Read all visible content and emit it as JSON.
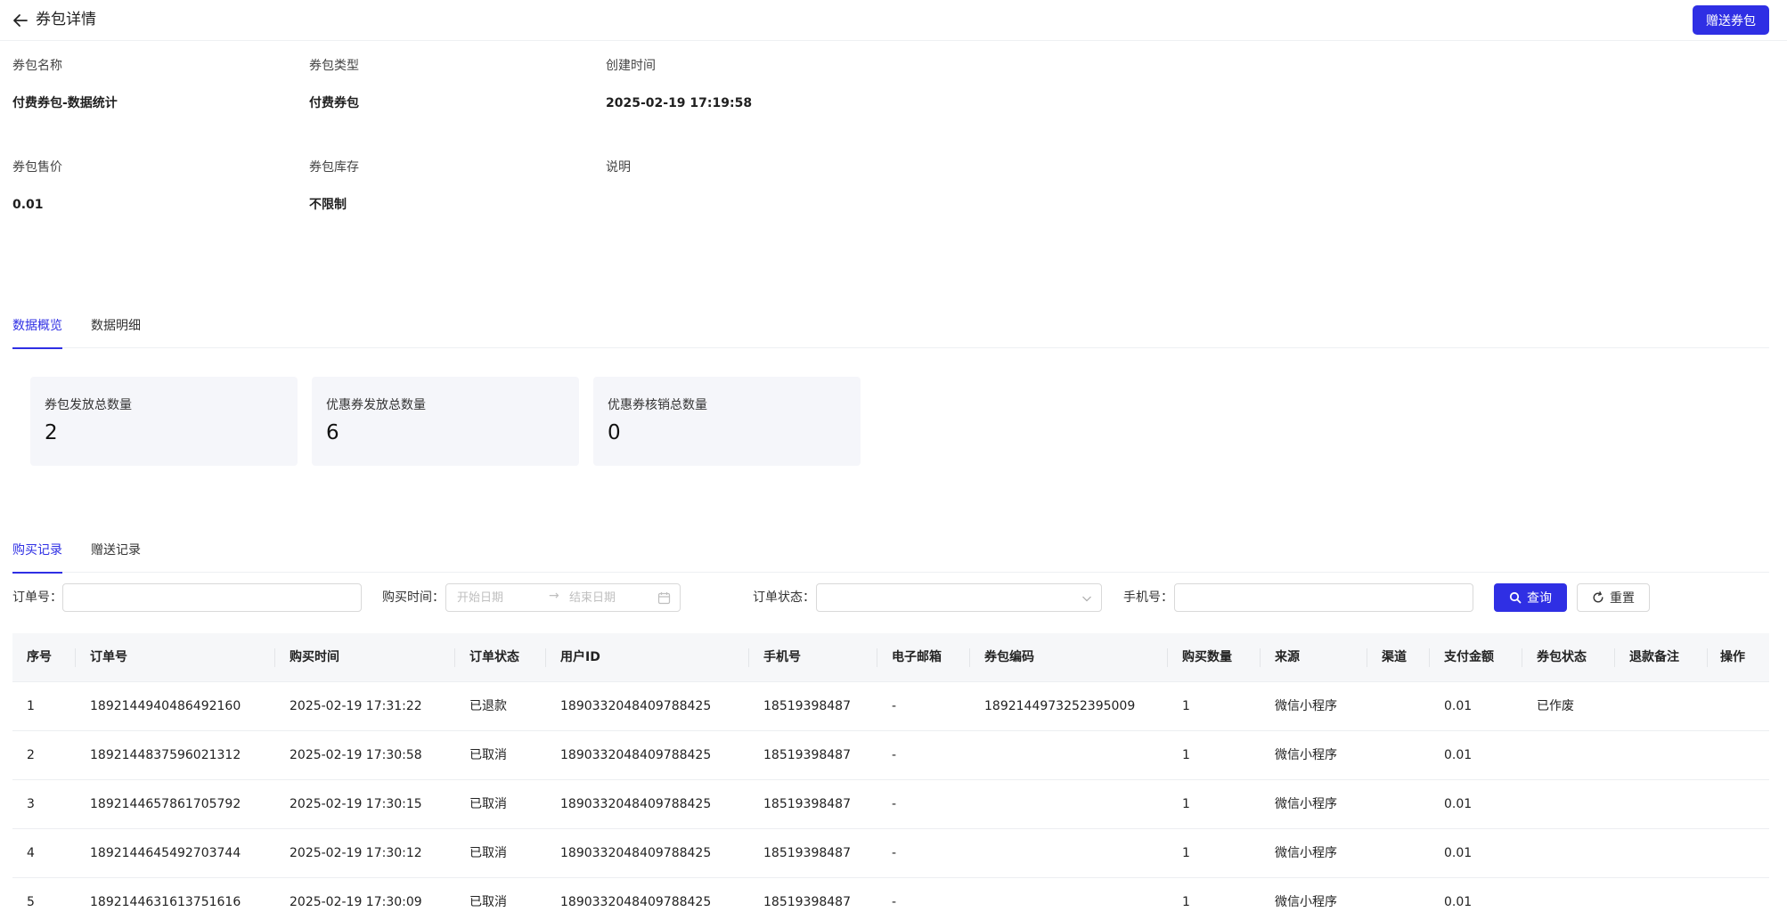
{
  "header": {
    "title": "券包详情",
    "gift_button": "赠送券包"
  },
  "info": [
    {
      "label": "券包名称",
      "value": "付费券包-数据统计"
    },
    {
      "label": "券包类型",
      "value": "付费券包"
    },
    {
      "label": "创建时间",
      "value": "2025-02-19 17:19:58"
    },
    {
      "label": "券包售价",
      "value": "0.01"
    },
    {
      "label": "券包库存",
      "value": "不限制"
    },
    {
      "label": "说明",
      "value": ""
    }
  ],
  "data_tabs": [
    {
      "label": "数据概览",
      "active": true
    },
    {
      "label": "数据明细",
      "active": false
    }
  ],
  "stats": [
    {
      "label": "券包发放总数量",
      "value": "2"
    },
    {
      "label": "优惠券发放总数量",
      "value": "6"
    },
    {
      "label": "优惠券核销总数量",
      "value": "0"
    }
  ],
  "record_tabs": [
    {
      "label": "购买记录",
      "active": true
    },
    {
      "label": "赠送记录",
      "active": false
    }
  ],
  "filters": {
    "order_no_label": "订单号：",
    "order_no_value": "",
    "purchase_time_label": "购买时间：",
    "start_placeholder": "开始日期",
    "end_placeholder": "结束日期",
    "date_arrow": "→",
    "order_status_label": "订单状态：",
    "order_status_value": "",
    "phone_label": "手机号：",
    "phone_value": "",
    "query_button": "查询",
    "reset_button": "重置"
  },
  "table": {
    "columns": [
      "序号",
      "订单号",
      "购买时间",
      "订单状态",
      "用户ID",
      "手机号",
      "电子邮箱",
      "券包编码",
      "购买数量",
      "来源",
      "渠道",
      "支付金额",
      "券包状态",
      "退款备注",
      "操作"
    ],
    "rows": [
      [
        "1",
        "1892144940486492160",
        "2025-02-19 17:31:22",
        "已退款",
        "1890332048409788425",
        "18519398487",
        "-",
        "1892144973252395009",
        "1",
        "微信小程序",
        "",
        "0.01",
        "已作废",
        "",
        ""
      ],
      [
        "2",
        "1892144837596021312",
        "2025-02-19 17:30:58",
        "已取消",
        "1890332048409788425",
        "18519398487",
        "-",
        "",
        "1",
        "微信小程序",
        "",
        "0.01",
        "",
        "",
        ""
      ],
      [
        "3",
        "1892144657861705792",
        "2025-02-19 17:30:15",
        "已取消",
        "1890332048409788425",
        "18519398487",
        "-",
        "",
        "1",
        "微信小程序",
        "",
        "0.01",
        "",
        "",
        ""
      ],
      [
        "4",
        "1892144645492703744",
        "2025-02-19 17:30:12",
        "已取消",
        "1890332048409788425",
        "18519398487",
        "-",
        "",
        "1",
        "微信小程序",
        "",
        "0.01",
        "",
        "",
        ""
      ],
      [
        "5",
        "1892144631613751616",
        "2025-02-19 17:30:09",
        "已取消",
        "1890332048409788425",
        "18519398487",
        "-",
        "",
        "1",
        "微信小程序",
        "",
        "0.01",
        "",
        "",
        ""
      ]
    ]
  }
}
